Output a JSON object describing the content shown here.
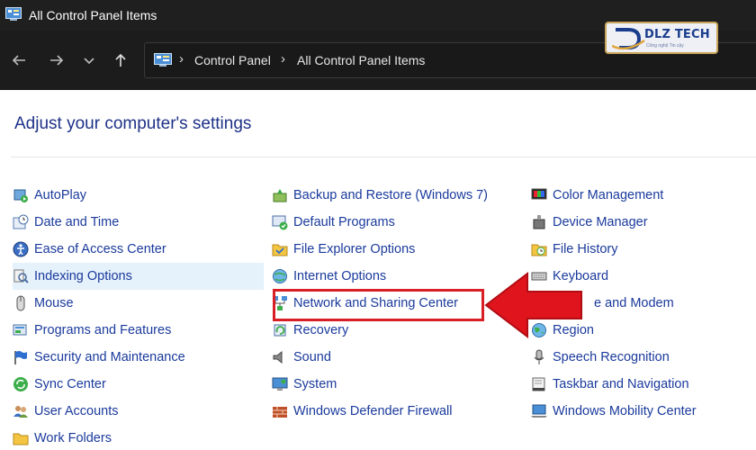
{
  "window": {
    "title": "All Control Panel Items"
  },
  "nav": {
    "back_icon": "arrow-left-icon",
    "forward_icon": "arrow-right-icon",
    "recent_icon": "chevron-down-icon",
    "up_icon": "arrow-up-icon"
  },
  "address_bar": {
    "separator": "›",
    "crumbs": [
      "Control Panel",
      "All Control Panel Items"
    ]
  },
  "logo": {
    "text": "DLZ TECH",
    "subtitle": "Công nghệ Tin cậy"
  },
  "main": {
    "heading": "Adjust your computer's settings",
    "columns": [
      [
        {
          "label": "AutoPlay",
          "icon": "autoplay-icon"
        },
        {
          "label": "Date and Time",
          "icon": "clock-calendar-icon"
        },
        {
          "label": "Ease of Access Center",
          "icon": "ease-of-access-icon"
        },
        {
          "label": "Indexing Options",
          "icon": "indexing-icon"
        },
        {
          "label": "Mouse",
          "icon": "mouse-icon"
        },
        {
          "label": "Programs and Features",
          "icon": "programs-icon"
        },
        {
          "label": "Security and Maintenance",
          "icon": "flag-icon"
        },
        {
          "label": "Sync Center",
          "icon": "sync-icon"
        },
        {
          "label": "User Accounts",
          "icon": "users-icon"
        },
        {
          "label": "Work Folders",
          "icon": "folder-icon"
        }
      ],
      [
        {
          "label": "Backup and Restore (Windows 7)",
          "icon": "backup-icon"
        },
        {
          "label": "Default Programs",
          "icon": "default-programs-icon"
        },
        {
          "label": "File Explorer Options",
          "icon": "folder-options-icon"
        },
        {
          "label": "Internet Options",
          "icon": "globe-icon"
        },
        {
          "label": "Network and Sharing Center",
          "icon": "network-icon"
        },
        {
          "label": "Recovery",
          "icon": "recovery-icon"
        },
        {
          "label": "Sound",
          "icon": "speaker-icon"
        },
        {
          "label": "System",
          "icon": "computer-icon"
        },
        {
          "label": "Windows Defender Firewall",
          "icon": "firewall-icon"
        }
      ],
      [
        {
          "label": "Color Management",
          "icon": "color-icon"
        },
        {
          "label": "Device Manager",
          "icon": "device-manager-icon"
        },
        {
          "label": "File History",
          "icon": "file-history-icon"
        },
        {
          "label": "Keyboard",
          "icon": "keyboard-icon"
        },
        {
          "label": "e and Modem",
          "icon": "phone-icon"
        },
        {
          "label": "Region",
          "icon": "region-icon"
        },
        {
          "label": "Speech Recognition",
          "icon": "microphone-icon"
        },
        {
          "label": "Taskbar and Navigation",
          "icon": "taskbar-icon"
        },
        {
          "label": "Windows Mobility Center",
          "icon": "mobility-icon"
        }
      ]
    ]
  },
  "colors": {
    "link": "#1a3a9c",
    "heading": "#1e3287",
    "hover": "#e5f1fb",
    "annotation": "#d81f26"
  }
}
